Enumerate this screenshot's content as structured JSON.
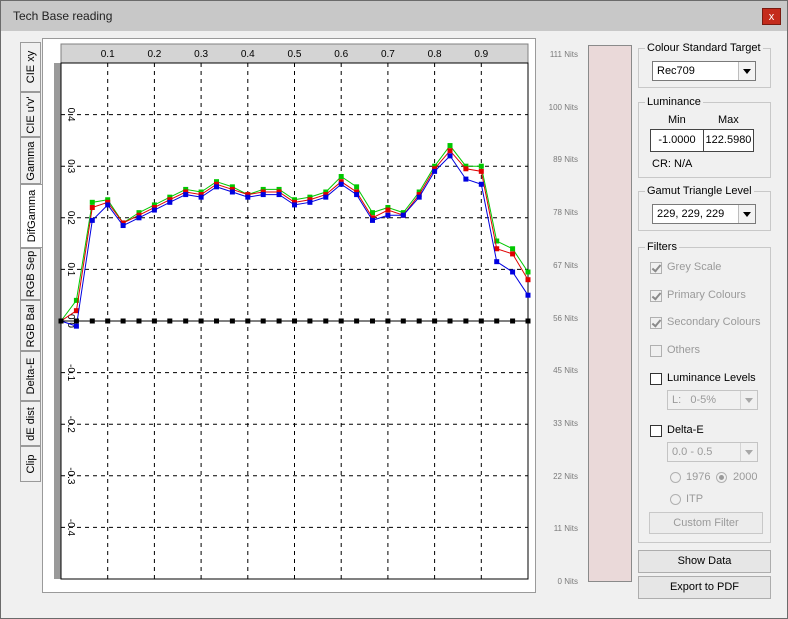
{
  "window": {
    "title": "Tech Base reading",
    "close_label": "x"
  },
  "tabs": [
    {
      "label": "CIE xy",
      "active": false
    },
    {
      "label": "CIE u'v'",
      "active": false
    },
    {
      "label": "Gamma",
      "active": false
    },
    {
      "label": "DifGamma",
      "active": true
    },
    {
      "label": "RGB Sep",
      "active": false
    },
    {
      "label": "RGB Bal",
      "active": false
    },
    {
      "label": "Delta-E",
      "active": false
    },
    {
      "label": "dE dist",
      "active": false
    },
    {
      "label": "Clip",
      "active": false
    }
  ],
  "chart_data": {
    "type": "line",
    "xlim": [
      0,
      1
    ],
    "ylim": [
      -0.5,
      0.5
    ],
    "x_ticks": [
      "0.1",
      "0.2",
      "0.3",
      "0.4",
      "0.5",
      "0.6",
      "0.7",
      "0.8",
      "0.9"
    ],
    "y_ticks": [
      "0.4",
      "0.3",
      "0.2",
      "0.1",
      "0.0",
      "-0.1",
      "-0.2",
      "-0.3",
      "-0.4"
    ],
    "grid": true,
    "x": [
      0,
      0.033,
      0.067,
      0.1,
      0.133,
      0.167,
      0.2,
      0.233,
      0.267,
      0.3,
      0.333,
      0.367,
      0.4,
      0.433,
      0.467,
      0.5,
      0.533,
      0.567,
      0.6,
      0.633,
      0.667,
      0.7,
      0.733,
      0.767,
      0.8,
      0.833,
      0.867,
      0.9,
      0.933,
      0.967,
      1.0
    ],
    "series": [
      {
        "color": "#00c800",
        "values": [
          0,
          0.04,
          0.23,
          0.235,
          0.19,
          0.21,
          0.225,
          0.24,
          0.255,
          0.25,
          0.27,
          0.26,
          0.245,
          0.255,
          0.255,
          0.235,
          0.24,
          0.25,
          0.28,
          0.26,
          0.21,
          0.22,
          0.21,
          0.25,
          0.3,
          0.34,
          0.3,
          0.3,
          0.155,
          0.14,
          0.095,
          0
        ]
      },
      {
        "color": "#e00000",
        "values": [
          0,
          0.02,
          0.22,
          0.23,
          0.19,
          0.205,
          0.22,
          0.235,
          0.25,
          0.245,
          0.265,
          0.255,
          0.245,
          0.25,
          0.25,
          0.23,
          0.235,
          0.245,
          0.27,
          0.25,
          0.2,
          0.215,
          0.205,
          0.245,
          0.295,
          0.33,
          0.295,
          0.29,
          0.14,
          0.13,
          0.08,
          0
        ]
      },
      {
        "color": "#0000e0",
        "values": [
          0,
          -0.01,
          0.195,
          0.225,
          0.185,
          0.2,
          0.215,
          0.23,
          0.245,
          0.24,
          0.26,
          0.25,
          0.24,
          0.245,
          0.245,
          0.225,
          0.23,
          0.24,
          0.265,
          0.245,
          0.195,
          0.205,
          0.205,
          0.24,
          0.29,
          0.32,
          0.275,
          0.265,
          0.115,
          0.095,
          0.05,
          0
        ]
      },
      {
        "color": "#000000",
        "values": [
          0,
          0,
          0,
          0,
          0,
          0,
          0,
          0,
          0,
          0,
          0,
          0,
          0,
          0,
          0,
          0,
          0,
          0,
          0,
          0,
          0,
          0,
          0,
          0,
          0,
          0,
          0,
          0,
          0,
          0,
          0,
          0
        ]
      }
    ]
  },
  "nits": {
    "labels": [
      "111 Nits",
      "100 Nits",
      "89 Nits",
      "78 Nits",
      "67 Nits",
      "56 Nits",
      "45 Nits",
      "33 Nits",
      "22 Nits",
      "11 Nits",
      "0 Nits"
    ]
  },
  "colour_standard": {
    "title": "Colour Standard Target",
    "value": "Rec709"
  },
  "luminance": {
    "title": "Luminance",
    "min_label": "Min",
    "max_label": "Max",
    "min_value": "-1.0000",
    "max_value": "122.5980",
    "cr_text": "CR: N/A"
  },
  "gamut": {
    "title": "Gamut Triangle Level",
    "value": "229, 229, 229"
  },
  "filters": {
    "title": "Filters",
    "grey_scale": {
      "label": "Grey Scale",
      "checked": true
    },
    "primary": {
      "label": "Primary Colours",
      "checked": true
    },
    "secondary": {
      "label": "Secondary Colours",
      "checked": true
    },
    "others": {
      "label": "Others",
      "checked": false
    },
    "luminance_levels": {
      "label": "Luminance Levels",
      "checked": false,
      "select_value": "L:   0-5%"
    },
    "delta_e": {
      "label": "Delta-E",
      "checked": false,
      "select_value": "0.0 - 0.5"
    },
    "radio_1976": "1976",
    "radio_2000": "2000",
    "radio_itp": "ITP",
    "custom_filter_label": "Custom Filter"
  },
  "buttons": {
    "show_data": "Show Data",
    "export_pdf": "Export to PDF"
  }
}
